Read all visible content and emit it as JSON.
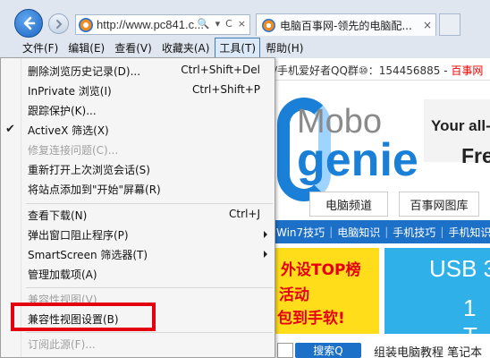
{
  "browser": {
    "address": "http://www.pc841.c...",
    "tab_title": "电脑百事网-领先的电脑配...",
    "tab_close": "×",
    "addr_buttons": [
      "🔍",
      "▾",
      "C",
      "×"
    ]
  },
  "menubar": [
    {
      "label": "文件(F)",
      "active": false
    },
    {
      "label": "编辑(E)",
      "active": false
    },
    {
      "label": "查看(V)",
      "active": false
    },
    {
      "label": "收藏夹(A)",
      "active": false
    },
    {
      "label": "工具(T)",
      "active": true
    },
    {
      "label": "帮助(H)",
      "active": false
    }
  ],
  "tools_menu": {
    "items": [
      {
        "label": "删除浏览历史记录(D)...",
        "shortcut": "Ctrl+Shift+Del",
        "disabled": false
      },
      {
        "label": "InPrivate 浏览(I)",
        "shortcut": "Ctrl+Shift+P",
        "disabled": false
      },
      {
        "label": "跟踪保护(K)...",
        "shortcut": "",
        "disabled": false
      },
      {
        "label": "ActiveX 筛选(X)",
        "shortcut": "",
        "disabled": false,
        "checked": true
      },
      {
        "label": "修复连接问题(C)...",
        "shortcut": "",
        "disabled": true
      },
      {
        "label": "重新打开上次浏览会话(S)",
        "shortcut": "",
        "disabled": false
      },
      {
        "label": "将站点添加到\"开始\"屏幕(R)",
        "shortcut": "",
        "disabled": false
      },
      {
        "label": "查看下载(N)",
        "shortcut": "Ctrl+J",
        "disabled": false
      },
      {
        "label": "弹出窗口阻止程序(P)",
        "shortcut": "",
        "disabled": false,
        "submenu": true
      },
      {
        "label": "SmartScreen 筛选器(T)",
        "shortcut": "",
        "disabled": false,
        "submenu": true
      },
      {
        "label": "管理加载项(A)",
        "shortcut": "",
        "disabled": false
      },
      {
        "label": "兼容性视图(V)",
        "shortcut": "",
        "disabled": true
      },
      {
        "label": "兼容性视图设置(B)",
        "shortcut": "",
        "disabled": false
      },
      {
        "label": "订阅此源(F)...",
        "shortcut": "",
        "disabled": true
      }
    ]
  },
  "page": {
    "info_strip": "/手机爱好者QQ群⑩：154456885 - ",
    "info_strip_red": "百事网",
    "ad1_brand_top": "Mobo",
    "ad1_brand_bottom": "genie",
    "ad1_text1": "Your all-in",
    "ad1_text2": "Fre",
    "channels": [
      "电脑频道",
      "百事网图库"
    ],
    "blue_nav": [
      "Win7技巧",
      "电脑知识",
      "手机技巧",
      "手机知识"
    ],
    "ad2_line1": "外设TOP榜",
    "ad2_line2": "活动",
    "ad2_line3": "包到手软!",
    "ad2_right1": "USB 3",
    "ad2_right2": "1 T",
    "search_button": "搜索Q",
    "search_links": "组装电脑教程 笔记本"
  },
  "colors": {
    "highlight": "#e3000f",
    "accent_blue": "#1d70c8"
  }
}
